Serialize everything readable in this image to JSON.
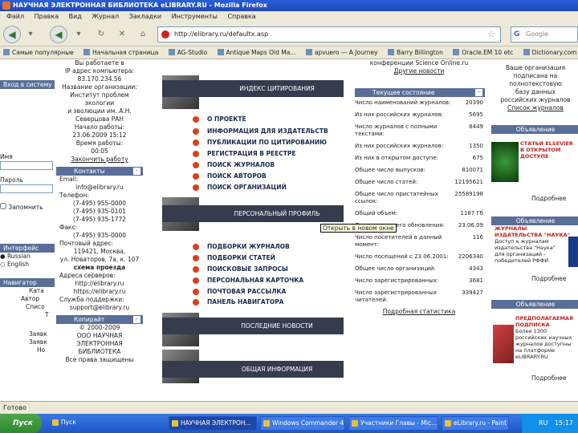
{
  "window": {
    "title": "НАУЧНАЯ ЭЛЕКТРОННАЯ БИБЛИОТЕКА eLIBRARY.RU - Mozilla Firefox"
  },
  "menu": [
    "Файл",
    "Правка",
    "Вид",
    "Журнал",
    "Закладки",
    "Инструменты",
    "Справка"
  ],
  "nav": {
    "url": "http://elibrary.ru/defaultx.asp",
    "search_placeholder": "Google"
  },
  "bookmarks": [
    "Самые популярные",
    "Начальная страница",
    "AG-Studio",
    "Antique Maps Old Ma...",
    "apvuero — A Journey",
    "Barry Billington",
    "Oracle.EM 10 etc",
    "Dictionary.com"
  ],
  "left": {
    "login_head": "Вход в систему",
    "login_label": "Имя",
    "password_label": "Пароль",
    "remember": "Запомнить",
    "lang_head": "Интерфейс",
    "lang_ru": "Russian",
    "lang_en": "English",
    "nav_head": "Навигатор",
    "side_items": [
      "Ката",
      "Автор",
      "Списо",
      "Т",
      "Заявк",
      "Заявк",
      "Но"
    ]
  },
  "session": {
    "rows": [
      "Вы работаете в",
      "IP адрес компьютера:",
      "83.170.234.56",
      "Название организации:",
      "Институт проблем экологии",
      "и эволюции им. А.Н.",
      "Северцова РАН",
      "Начало работы:",
      "23.06.2009 15:12",
      "Время работы:",
      "00:05"
    ],
    "logout": "Закончить работу"
  },
  "contacts": {
    "head": "Контакты",
    "rows": [
      "Email:",
      "info@elibrary.ru",
      "Телефон:",
      "(7-495) 955-0000",
      "(7-495) 935-0101",
      "(7-495) 935-1772",
      "Факс:",
      "(7-495) 935-0000",
      "Почтовый адрес:",
      "119421, Москва,",
      "ул. Новаторов, 7а, к. 107",
      "схема проезда",
      "Адреса серверов:",
      "http://elibrary.ru",
      "https://elibrary.ru",
      "Служба поддержки:",
      "support@elibrary.ru"
    ]
  },
  "copyright": {
    "head": "Копирайт",
    "rows": [
      "© 2000-2009",
      "ООО НАУЧНАЯ",
      "ЭЛЕКТРОННАЯ",
      "БИБЛИОТЕКА",
      "Все права защищены"
    ]
  },
  "center": {
    "sections": [
      {
        "title": "ИНДЕКС ЦИТИРОВАНИЯ"
      },
      {
        "title": "ПЕРСОНАЛЬНЫЙ ПРОФИЛЬ"
      },
      {
        "title": "ПОСЛЕДНИЕ НОВОСТИ"
      },
      {
        "title": "ОБЩАЯ ИНФОРМАЦИЯ"
      }
    ],
    "links_citation": [
      "О ПРОЕКТЕ",
      "ИНФОРМАЦИЯ ДЛЯ ИЗДАТЕЛЬСТВ",
      "ПУБЛИКАЦИИ ПО ЦИТИРОВАНИЮ",
      "РЕГИСТРАЦИЯ В РЕЕСТРЕ",
      "ПОИСК ЖУРНАЛОВ",
      "ПОИСК АВТОРОВ",
      "ПОИСК ОРГАНИЗАЦИЙ"
    ],
    "links_profile": [
      "ПОДБОРКИ ЖУРНАЛОВ",
      "ПОДБОРКИ СТАТЕЙ",
      "ПОИСКОВЫЕ ЗАПРОСЫ",
      "ПЕРСОНАЛЬНАЯ КАРТОЧКА",
      "ПОЧТОВАЯ РАССЫЛКА",
      "ПАНЕЛЬ НАВИГАТОРА"
    ]
  },
  "stats": {
    "top_note": "конференции Science Online.ru",
    "top_more": "Другие новости",
    "head": "Текущее состояние",
    "rows": [
      {
        "label": "Число наименований журналов:",
        "value": "20390"
      },
      {
        "label": "Из них российских журналов:",
        "value": "5695"
      },
      {
        "label": "Число журналов с полными текстами:",
        "value": "8449"
      },
      {
        "label": "Из них российских журналов:",
        "value": "1350"
      },
      {
        "label": "Из них в открытом доступе:",
        "value": "675"
      },
      {
        "label": "Общее число выпусков:",
        "value": "810071"
      },
      {
        "label": "Общее число статей:",
        "value": "12195621"
      },
      {
        "label": "Общее число пристатейных ссылок:",
        "value": "25589198"
      },
      {
        "label": "Общий объем:",
        "value": "1187 Гб"
      },
      {
        "label": "Дата последнего обновления:",
        "value": "23.06.09"
      },
      {
        "label": "Число посетителей в данный момент:",
        "value": "116"
      },
      {
        "label": "Число посещений с 23.06.2001:",
        "value": "2206340"
      },
      {
        "label": "Общее число организаций:",
        "value": "4343"
      },
      {
        "label": "Число зарегистрированных:",
        "value": "3681"
      },
      {
        "label": "Число зарегистрированных читателей:",
        "value": "339427"
      }
    ],
    "more": "Подробная статистика"
  },
  "tooltip": "Открыть в новом окне",
  "right": {
    "promo_top": [
      "Ваше организация",
      "подписана на",
      "полнотекстовую",
      "базу данных",
      "российских журналов"
    ],
    "promo_top_link": "Список журналов",
    "ad_head": "Объявление",
    "ad1": [
      "СТАТЬИ ELSEVIER",
      "В ОТКРЫТОМ",
      "ДОСТУПЕ"
    ],
    "ad1_more": "Подробнее",
    "ad2": [
      "ЖУРНАЛЫ",
      "ИЗДАТЕЛЬСТВА \"НАУКА\"",
      "Доступ к журналам",
      "издательства \"Наука\"",
      "для организаций -",
      "победителей РФФИ"
    ],
    "ad2_more": "Подробнее",
    "ad3": [
      "ПРЕДПОЛАГАЕМАЯ",
      "ПОДПИСКА",
      "Более 1300",
      "российских научных",
      "журналов доступны",
      "на платформе",
      "eLIBRARY.RU"
    ],
    "ad3_more": "Подробнее"
  },
  "status": "Готово",
  "taskbar": {
    "start": "Пуск",
    "items": [
      "Пуск",
      "НАУЧНАЯ ЭЛЕКТРОН...",
      "Windows Commander 4...",
      "Участники Главы - Mic...",
      "eLibrary.ru - Paint"
    ],
    "lang": "RU",
    "clock": "15:17"
  }
}
